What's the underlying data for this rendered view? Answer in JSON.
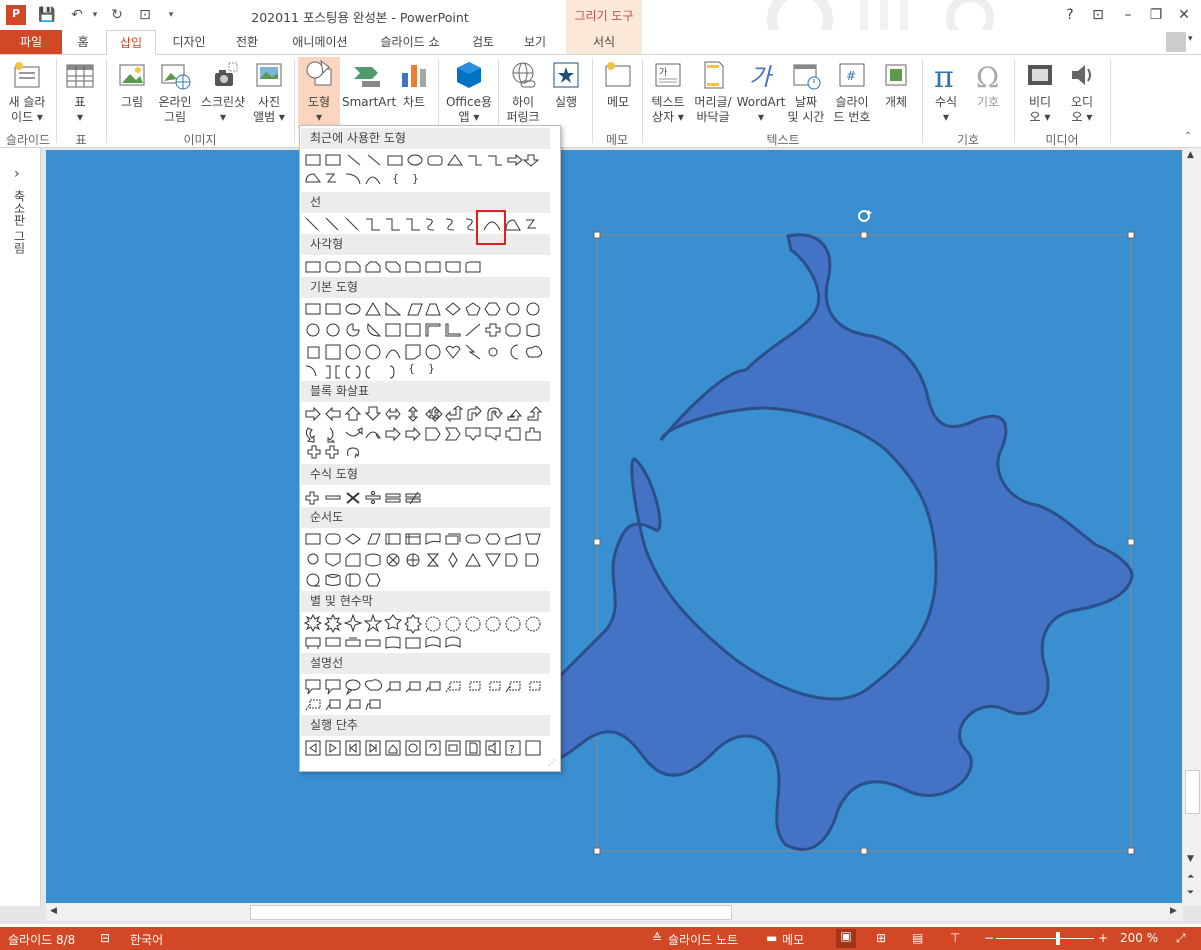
{
  "window": {
    "title": "202011 포스팅용 완성본 - PowerPoint",
    "contextual_tab_group": "그리기 도구",
    "help": "?",
    "colors": {
      "accent": "#d24726",
      "slide_bg": "#3a8fd1",
      "shape_fill": "#4472c4",
      "shape_stroke": "#2a4f8a",
      "highlight": "#e02020"
    }
  },
  "tabs": {
    "file": "파일",
    "home": "홈",
    "insert": "삽입",
    "design": "디자인",
    "transitions": "전환",
    "animations": "애니메이션",
    "slideshow": "슬라이드 쇼",
    "review": "검토",
    "view": "보기",
    "format": "서식"
  },
  "ribbon": {
    "new_slide": [
      "새 슬라",
      "이드 ▾"
    ],
    "table": [
      "표",
      "▾"
    ],
    "picture": "그림",
    "online_picture": [
      "온라인",
      "그림"
    ],
    "screenshot": [
      "스크린샷",
      "▾"
    ],
    "photo_album": [
      "사진",
      "앨범 ▾"
    ],
    "shapes": [
      "도형",
      "▾"
    ],
    "smartart": "SmartArt",
    "chart": "차트",
    "office_apps": [
      "Office용",
      "앱 ▾"
    ],
    "hyperlink": [
      "하이",
      "퍼링크"
    ],
    "action": "실행",
    "comment": "메모",
    "textbox": [
      "텍스트",
      "상자 ▾"
    ],
    "header_footer": [
      "머리글/",
      "바닥글"
    ],
    "wordart": [
      "WordArt",
      "▾"
    ],
    "date_time": [
      "날짜",
      "및 시간"
    ],
    "slide_number": [
      "슬라이",
      "드 번호"
    ],
    "object": "개체",
    "equation": [
      "수식",
      "▾"
    ],
    "symbol": "기호",
    "video": [
      "비디",
      "오 ▾"
    ],
    "audio": [
      "오디",
      "오 ▾"
    ],
    "groups": {
      "slides": "슬라이드",
      "tables": "표",
      "images": "이미지",
      "comments": "메모",
      "text": "텍스트",
      "symbols": "기호",
      "media": "미디어"
    }
  },
  "left_panel": {
    "label": "축소판 그림",
    "expand": "›"
  },
  "dropdown": {
    "sections": [
      "최근에 사용한 도형",
      "선",
      "사각형",
      "기본 도형",
      "블록 화살표",
      "수식 도형",
      "순서도",
      "별 및 현수막",
      "설명선",
      "실행 단추"
    ],
    "brace_glyphs": [
      "{",
      "}"
    ],
    "highlighted_shape": "curve-line"
  },
  "status": {
    "slide_info": "슬라이드 8/8",
    "language": "한국어",
    "notes": "슬라이드 노트",
    "comments": "메모",
    "zoom": "200 %",
    "zoom_out": "−",
    "zoom_in": "+"
  }
}
